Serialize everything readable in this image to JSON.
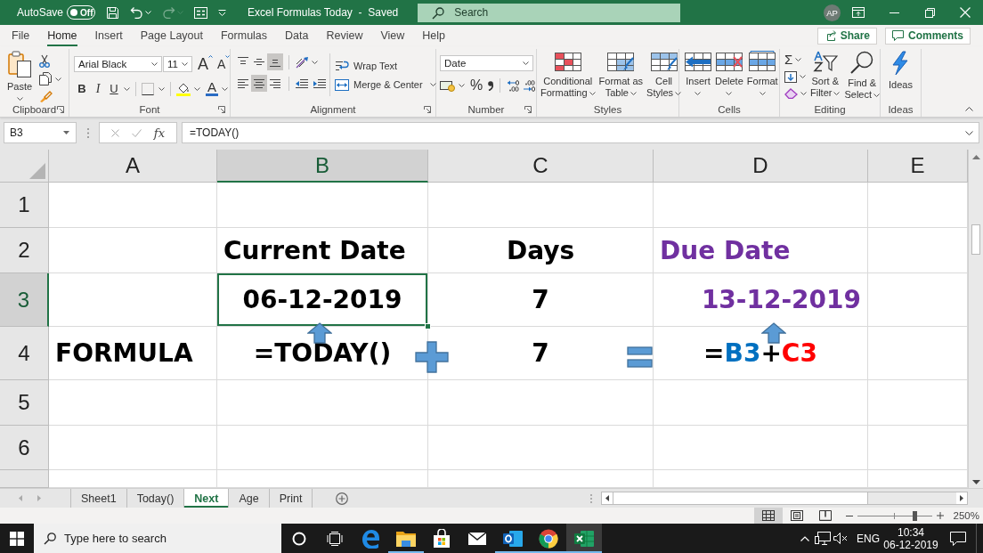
{
  "title_bar": {
    "autosave": {
      "label": "AutoSave",
      "toggle": "Off",
      "on": false
    },
    "quick_access": [
      {
        "kind": "save",
        "disabled": false
      },
      {
        "kind": "undo",
        "disabled": false
      },
      {
        "kind": "redo",
        "disabled": true
      },
      {
        "kind": "form",
        "disabled": false
      },
      {
        "kind": "customize",
        "disabled": false
      }
    ],
    "title": "Excel Formulas Today  -  Saved",
    "search": {
      "placeholder": "Search"
    },
    "avatar": "AP"
  },
  "ribbon_tabs": [
    {
      "label": "File",
      "selected": false
    },
    {
      "label": "Home",
      "selected": true
    },
    {
      "label": "Insert",
      "selected": false
    },
    {
      "label": "Page Layout",
      "selected": false
    },
    {
      "label": "Formulas",
      "selected": false
    },
    {
      "label": "Data",
      "selected": false
    },
    {
      "label": "Review",
      "selected": false
    },
    {
      "label": "View",
      "selected": false
    },
    {
      "label": "Help",
      "selected": false
    }
  ],
  "share": "Share",
  "comments": "Comments",
  "ribbon_groups": [
    {
      "kind": "clipboard",
      "label": "Clipboard",
      "paste": "Paste"
    },
    {
      "kind": "font",
      "label": "Font",
      "font_name": "Arial Black",
      "font_size": "11",
      "grow": "A",
      "shrink": "A",
      "styles": [
        {
          "kind": "bold",
          "label": "B"
        },
        {
          "kind": "italic",
          "label": "I"
        },
        {
          "kind": "underline",
          "label": "U"
        }
      ],
      "font_color": "A"
    },
    {
      "kind": "alignment",
      "label": "Alignment",
      "vertical_align": [
        {
          "kind": "top",
          "selected": false
        },
        {
          "kind": "middle",
          "selected": false
        },
        {
          "kind": "bottom",
          "selected": true
        }
      ],
      "horizontal_align": [
        {
          "kind": "left",
          "selected": false
        },
        {
          "kind": "center",
          "selected": true
        },
        {
          "kind": "right",
          "selected": false
        }
      ],
      "wrap_text": "Wrap Text",
      "merge": "Merge & Center"
    },
    {
      "kind": "number",
      "label": "Number",
      "format": "Date",
      "percent": "%"
    },
    {
      "kind": "styles",
      "label": "Styles",
      "buttons": [
        {
          "kind": "conditional",
          "lines": [
            "Conditional",
            "Formatting"
          ]
        },
        {
          "kind": "table",
          "lines": [
            "Format as",
            "Table"
          ]
        },
        {
          "kind": "cell-styles",
          "lines": [
            "Cell",
            "Styles"
          ]
        }
      ]
    },
    {
      "kind": "cells",
      "label": "Cells",
      "buttons": [
        {
          "kind": "insert",
          "lines": [
            "Insert"
          ]
        },
        {
          "kind": "delete",
          "lines": [
            "Delete"
          ]
        },
        {
          "kind": "format",
          "lines": [
            "Format"
          ]
        }
      ]
    },
    {
      "kind": "editing",
      "label": "Editing",
      "autosum": "Σ",
      "buttons": [
        {
          "kind": "sort",
          "lines": [
            "Sort &",
            "Filter"
          ]
        },
        {
          "kind": "find",
          "lines": [
            "Find &",
            "Select"
          ]
        }
      ]
    },
    {
      "kind": "ideas",
      "label": "Ideas",
      "buttons": [
        {
          "kind": "ideas",
          "lines": [
            "Ideas"
          ]
        }
      ]
    }
  ],
  "formula_bar": {
    "name_box": "B3",
    "function_button": "fx",
    "formula": "=TODAY()"
  },
  "sheet": {
    "columns": [
      {
        "label": "A",
        "selected": false
      },
      {
        "label": "B",
        "selected": true
      },
      {
        "label": "C",
        "selected": false
      },
      {
        "label": "D",
        "selected": false
      },
      {
        "label": "E",
        "selected": false
      }
    ],
    "rows": [
      {
        "label": "1",
        "selected": false
      },
      {
        "label": "2",
        "selected": false,
        "cells": [
          null,
          {
            "text": "Current Date",
            "color": "#000000",
            "selected": false
          },
          {
            "text": "Days",
            "color": "#000000",
            "selected": false
          },
          {
            "text": "Due Date",
            "color": "#7030a0",
            "selected": false
          },
          null
        ]
      },
      {
        "label": "3",
        "selected": true,
        "cells": [
          null,
          {
            "text": "06-12-2019",
            "color": "#000000",
            "selected": true
          },
          {
            "text": "7",
            "color": "#000000",
            "selected": false
          },
          {
            "text": "13-12-2019",
            "color": "#7030a0",
            "selected": false
          },
          null
        ]
      },
      {
        "label": "4",
        "selected": false,
        "cells": [
          {
            "text": "FORMULA",
            "color": "#000000",
            "selected": false
          },
          {
            "text": "=TODAY()",
            "color": "#000000",
            "selected": false
          },
          {
            "text": "7",
            "color": "#000000",
            "selected": false
          },
          {
            "segments": [
              {
                "text": "=",
                "color": "#000000"
              },
              {
                "text": "B3",
                "color": "#0070c0"
              },
              {
                "text": "+",
                "color": "#000000"
              },
              {
                "text": "C3",
                "color": "#ff0000"
              }
            ],
            "selected": false
          },
          null
        ]
      },
      {
        "label": "5",
        "selected": false
      },
      {
        "label": "6",
        "selected": false
      },
      {
        "selected": false
      }
    ]
  },
  "sheet_tabs": [
    {
      "label": "Sheet1",
      "selected": false
    },
    {
      "label": "Today()",
      "selected": false
    },
    {
      "label": "Next",
      "selected": true
    },
    {
      "label": "Age",
      "selected": false
    },
    {
      "label": "Print",
      "selected": false
    }
  ],
  "status_bar": {
    "views": [
      {
        "kind": "normal",
        "selected": true
      },
      {
        "kind": "page-layout",
        "selected": false
      },
      {
        "kind": "page-break",
        "selected": false
      }
    ],
    "zoom": {
      "level": 0.77,
      "reading": "250%"
    }
  },
  "taskbar": {
    "search": {
      "placeholder": "Type here to search"
    },
    "apps": [
      {
        "kind": "cortana",
        "running": false,
        "selected": false
      },
      {
        "kind": "task-view",
        "running": false,
        "selected": false
      },
      {
        "kind": "edge",
        "running": false,
        "selected": false
      },
      {
        "kind": "explorer",
        "running": true,
        "selected": false
      },
      {
        "kind": "store",
        "running": false,
        "selected": false
      },
      {
        "kind": "mail",
        "running": false,
        "selected": false
      },
      {
        "kind": "outlook",
        "running": true,
        "selected": false
      },
      {
        "kind": "chrome",
        "running": true,
        "selected": false
      },
      {
        "kind": "excel",
        "running": true,
        "selected": true
      }
    ],
    "language": "ENG",
    "time": "10:34",
    "date": "06-12-2019"
  }
}
